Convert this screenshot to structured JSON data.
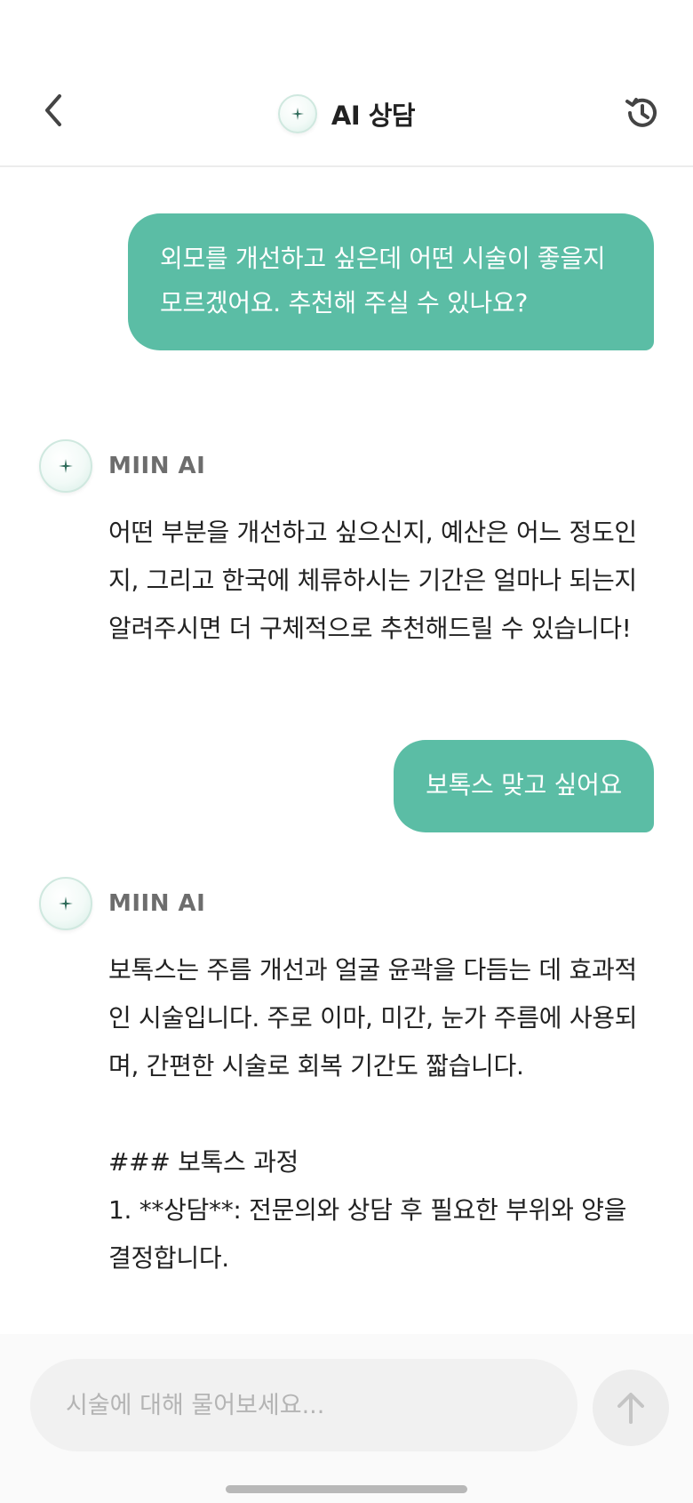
{
  "header": {
    "title": "AI 상담",
    "back_icon": "chevron-left-icon",
    "history_icon": "history-clock-icon",
    "avatar_icon": "sparkle-icon"
  },
  "messages": [
    {
      "role": "user",
      "text": "외모를 개선하고 싶은데 어떤 시술이 좋을지 모르겠어요. 추천해 주실 수 있나요?"
    },
    {
      "role": "assistant",
      "sender": "MIIN AI",
      "text": "어떤 부분을 개선하고 싶으신지, 예산은 어느 정도인지, 그리고 한국에 체류하시는 기간은 얼마나 되는지 알려주시면 더 구체적으로 추천해드릴 수 있습니다!"
    },
    {
      "role": "user",
      "text": "보톡스 맞고 싶어요"
    },
    {
      "role": "assistant",
      "sender": "MIIN AI",
      "text": "보톡스는 주름 개선과 얼굴 윤곽을 다듬는 데 효과적인 시술입니다. 주로 이마, 미간, 눈가 주름에 사용되며, 간편한 시술로 회복 기간도 짧습니다.\n\n### 보톡스 과정\n1. **상담**: 전문의와 상담 후 필요한 부위와 양을 결정합니다."
    }
  ],
  "composer": {
    "placeholder": "시술에 대해 물어보세요...",
    "value": "",
    "send_icon": "arrow-up-icon"
  },
  "colors": {
    "accent": "#5bbda5",
    "user_bubble_text": "#ffffff",
    "sender_name": "#6d6d6d"
  }
}
